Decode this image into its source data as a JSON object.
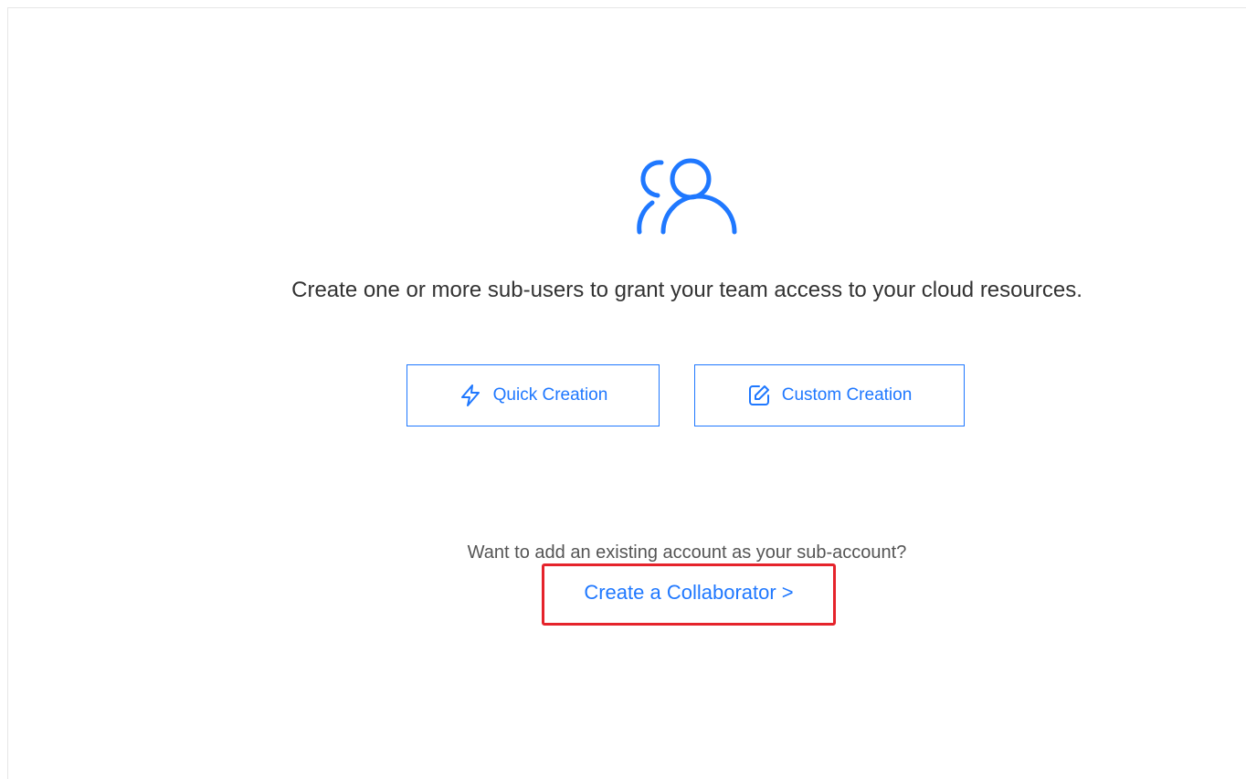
{
  "empty_state": {
    "icon": "users-icon",
    "message": "Create one or more sub-users to grant your team access to your cloud resources."
  },
  "actions": {
    "quick_creation": {
      "label": "Quick Creation",
      "icon": "lightning-icon"
    },
    "custom_creation": {
      "label": "Custom Creation",
      "icon": "edit-icon"
    }
  },
  "collaborator": {
    "question": "Want to add an existing account as your sub-account?",
    "link_label": "Create a Collaborator >"
  },
  "colors": {
    "accent": "#1f78ff",
    "text": "#333333",
    "highlight": "#e5232b"
  }
}
